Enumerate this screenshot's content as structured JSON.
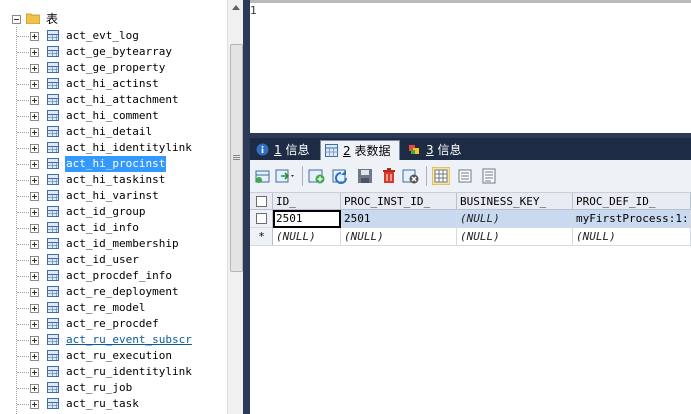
{
  "tree": {
    "root_label": "表",
    "items": [
      {
        "label": "act_evt_log"
      },
      {
        "label": "act_ge_bytearray"
      },
      {
        "label": "act_ge_property"
      },
      {
        "label": "act_hi_actinst"
      },
      {
        "label": "act_hi_attachment"
      },
      {
        "label": "act_hi_comment"
      },
      {
        "label": "act_hi_detail"
      },
      {
        "label": "act_hi_identitylink"
      },
      {
        "label": "act_hi_procinst",
        "selected": true
      },
      {
        "label": "act_hi_taskinst"
      },
      {
        "label": "act_hi_varinst"
      },
      {
        "label": "act_id_group"
      },
      {
        "label": "act_id_info"
      },
      {
        "label": "act_id_membership"
      },
      {
        "label": "act_id_user"
      },
      {
        "label": "act_procdef_info"
      },
      {
        "label": "act_re_deployment"
      },
      {
        "label": "act_re_model"
      },
      {
        "label": "act_re_procdef"
      },
      {
        "label": "act_ru_event_subscr",
        "link": true
      },
      {
        "label": "act_ru_execution"
      },
      {
        "label": "act_ru_identitylink"
      },
      {
        "label": "act_ru_job"
      },
      {
        "label": "act_ru_task"
      }
    ]
  },
  "editor": {
    "line_number": "1"
  },
  "tabs": [
    {
      "num": "1",
      "label": "信息",
      "icon": "info-icon"
    },
    {
      "num": "2",
      "label": "表数据",
      "icon": "table-data-icon",
      "active": true
    },
    {
      "num": "3",
      "label": "信息",
      "icon": "message-icon"
    }
  ],
  "toolbar": {
    "icons": [
      "grid-add-icon",
      "export-dropdown-icon",
      "insert-row-icon",
      "refresh-icon",
      "save-icon",
      "delete-icon",
      "cancel-icon",
      "grid-view-icon",
      "form-view-icon",
      "text-view-icon"
    ]
  },
  "grid": {
    "columns": [
      "ID_",
      "PROC_INST_ID_",
      "BUSINESS_KEY_",
      "PROC_DEF_ID_"
    ],
    "rows": [
      {
        "marker": "",
        "cells": [
          "2501",
          "2501",
          "(NULL)",
          "myFirstProcess:1:"
        ]
      },
      {
        "marker": "*",
        "cells": [
          "(NULL)",
          "(NULL)",
          "(NULL)",
          "(NULL)"
        ]
      }
    ]
  },
  "colors": {
    "selection": "#3399ff",
    "dark_panel": "#1d2b44",
    "row_highlight": "#c9daf0"
  }
}
